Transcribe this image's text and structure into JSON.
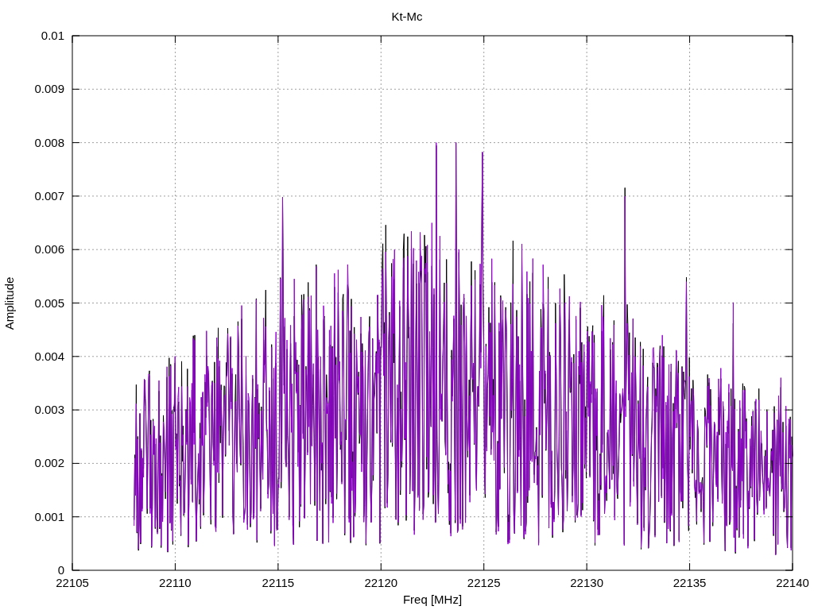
{
  "title": "Kt-Mc",
  "xlabel": "Freq [MHz]",
  "ylabel": "Amplitude",
  "x_ticks": [
    "22105",
    "22110",
    "22115",
    "22120",
    "22125",
    "22130",
    "22135",
    "22140"
  ],
  "y_ticks": [
    "0.01",
    "0.009",
    "0.008",
    "0.007",
    "0.006",
    "0.005",
    "0.004",
    "0.003",
    "0.002",
    "0.001",
    "0"
  ],
  "traces": [
    {
      "color": "#000000"
    },
    {
      "color": "#9400d3"
    }
  ]
}
